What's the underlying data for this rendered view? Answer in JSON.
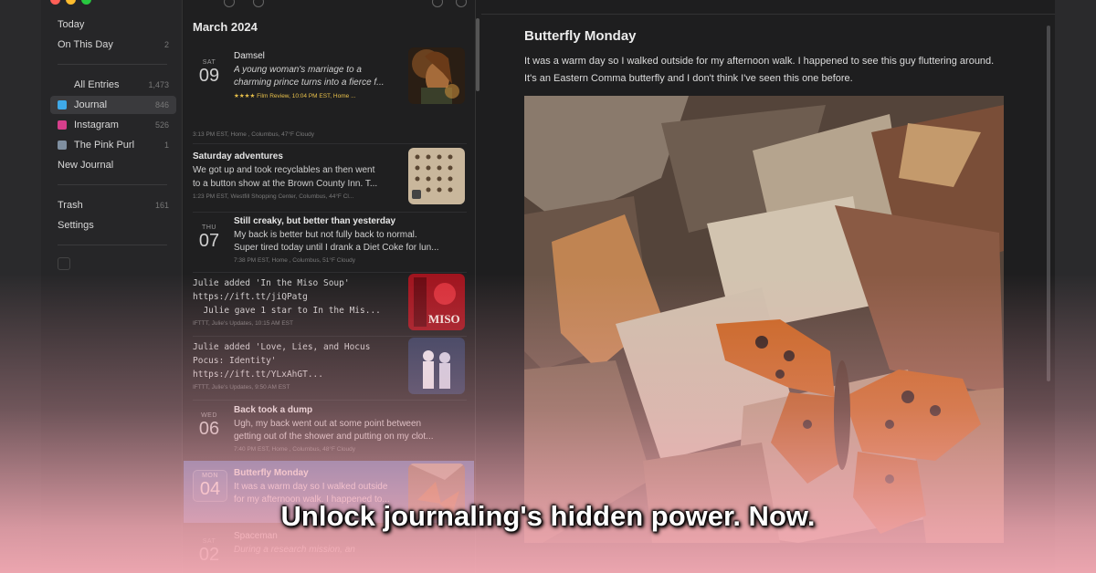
{
  "sidebar": {
    "items": [
      {
        "label": "Today",
        "count": ""
      },
      {
        "label": "On This Day",
        "count": "2"
      },
      {
        "label": "All Entries",
        "count": "1,473"
      },
      {
        "label": "Journal",
        "count": "846",
        "color": "#3fa9e8"
      },
      {
        "label": "Instagram",
        "count": "526",
        "color": "#d63f8c"
      },
      {
        "label": "The Pink Purl",
        "count": "1",
        "color": "#7f8fa0"
      },
      {
        "label": "New Journal",
        "count": ""
      },
      {
        "label": "Trash",
        "count": "161"
      },
      {
        "label": "Settings",
        "count": ""
      }
    ]
  },
  "list": {
    "month": "March 2024",
    "entries": [
      {
        "dow": "SAT",
        "day": "09",
        "title": "Damsel",
        "body1": "A young woman's marriage to a",
        "body2": "charming prince turns into a fierce f...",
        "meta": "★★★★ Film Review, 10:04 PM EST, Home ..."
      },
      {
        "dow": "",
        "day": "",
        "title": "",
        "body1": "",
        "body2": "",
        "meta": "3:13 PM EST, Home , Columbus, 47°F Cloudy"
      },
      {
        "dow": "",
        "day": "",
        "title": "Saturday adventures",
        "body1": "We got up and took recyclables an then went",
        "body2": "to a button show at the Brown County Inn. T...",
        "meta": "1:23 PM EST, Westfill Shopping Center, Columbus, 44°F Cl..."
      },
      {
        "dow": "THU",
        "day": "07",
        "title": "Still creaky, but better than yesterday",
        "body1": "My back is better but not fully back to normal.",
        "body2": "Super tired today until I drank a Diet Coke for lun...",
        "meta": "7:38 PM EST, Home , Columbus, 51°F Cloudy"
      },
      {
        "dow": "",
        "day": "",
        "title": "",
        "body1": "Julie added 'In the Miso Soup'",
        "body2": "https://ift.tt/jiQPatg",
        "body3": "  Julie gave 1 star to In the Mis...",
        "meta": "IFTTT, Julie's Updates, 10:15 AM EST"
      },
      {
        "dow": "",
        "day": "",
        "title": "",
        "body1": "Julie added 'Love, Lies, and Hocus",
        "body2": "Pocus: Identity'",
        "body3": "https://ift.tt/YLxAhGT...",
        "meta": "IFTTT, Julie's Updates, 9:50 AM EST"
      },
      {
        "dow": "WED",
        "day": "06",
        "title": "Back took a dump",
        "body1": "Ugh, my back went out at some point between",
        "body2": "getting out of the shower and putting on my clot...",
        "meta": "7:40 PM EST, Home , Columbus, 48°F Cloudy"
      },
      {
        "dow": "MON",
        "day": "04",
        "title": "Butterfly Monday",
        "body1": "It was a warm day so I walked outside",
        "body2": "for my afternoon walk. I happened to...",
        "meta": ""
      },
      {
        "dow": "SAT",
        "day": "02",
        "title": "Spaceman",
        "body1": "During a research mission, an",
        "body2": "",
        "meta": ""
      }
    ]
  },
  "detail": {
    "title": "Butterfly Monday",
    "text": "It was a warm day so I walked outside for my afternoon walk. I happened to see this guy fluttering around. It's an Eastern Comma butterfly and I don't think I've seen this one before."
  },
  "headline": "Unlock journaling's hidden power. Now.",
  "colors": {
    "accent": "#3fa9e8",
    "selected": "#4a6aa8",
    "overlay": "#f0a6b0"
  }
}
